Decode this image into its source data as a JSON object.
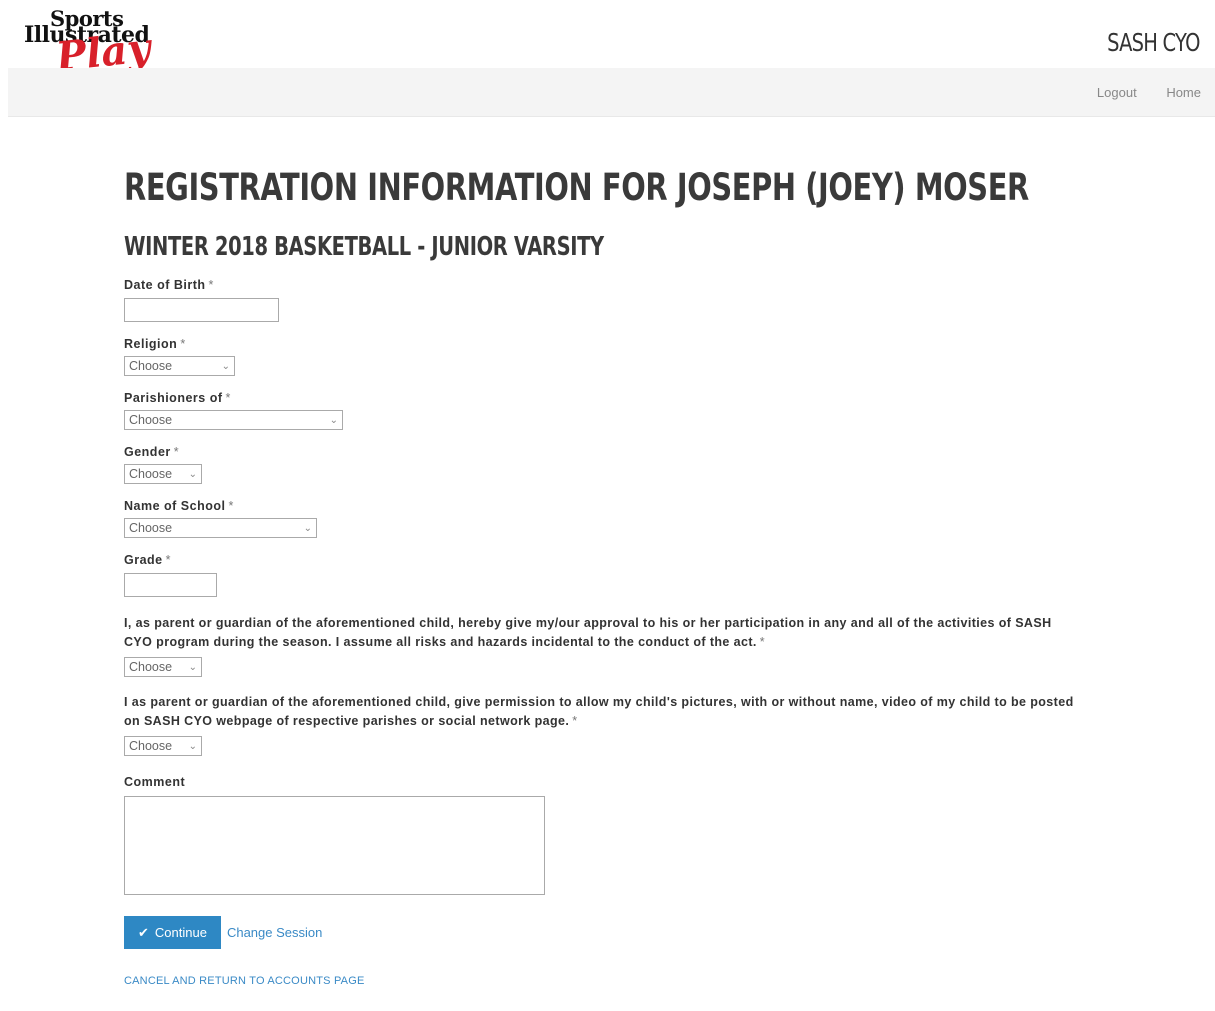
{
  "header": {
    "logo_line1": "Sports",
    "logo_line2": "Illustrated",
    "logo_line3": "Play",
    "site_name": "SASH CYO",
    "nav": {
      "logout": "Logout",
      "home": "Home"
    }
  },
  "page": {
    "title": "REGISTRATION INFORMATION FOR JOSEPH (JOEY) MOSER",
    "subtitle": "WINTER 2018 BASKETBALL - JUNIOR VARSITY"
  },
  "form": {
    "required_marker": "*",
    "dob": {
      "label": "Date of Birth",
      "value": ""
    },
    "religion": {
      "label": "Religion",
      "selected": "Choose"
    },
    "parishioners": {
      "label": "Parishioners of",
      "selected": "Choose"
    },
    "gender": {
      "label": "Gender",
      "selected": "Choose"
    },
    "school": {
      "label": "Name of School",
      "selected": "Choose"
    },
    "grade": {
      "label": "Grade",
      "value": ""
    },
    "approval": {
      "text": "I, as parent or guardian of the aforementioned child, hereby give my/our approval to his or her participation in any and all of the activities of SASH CYO program during the season. I assume all risks and hazards incidental to the conduct of the act.",
      "selected": "Choose"
    },
    "photo_permission": {
      "text": "I as parent or guardian of the aforementioned child, give permission to allow my child's pictures, with or without name, video of my child to be posted on SASH CYO webpage of respective parishes or social network page.",
      "selected": "Choose"
    },
    "comment": {
      "label": "Comment",
      "value": ""
    }
  },
  "actions": {
    "continue_label": "Continue",
    "change_session": "Change Session",
    "cancel": "CANCEL AND RETURN TO ACCOUNTS PAGE"
  },
  "icons": {
    "continue": "check-icon",
    "dropdown": "chevron-down-icon"
  },
  "colors": {
    "primary_button": "#2e88c4",
    "link": "#3a8ac6",
    "logo_red": "#d8202a",
    "navbar_bg": "#f4f4f4"
  }
}
